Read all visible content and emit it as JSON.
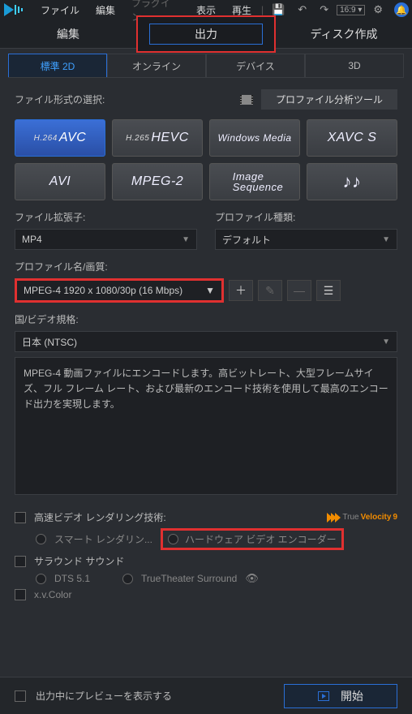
{
  "menu": {
    "file": "ファイル",
    "edit": "編集",
    "plugin": "プラグイン",
    "view": "表示",
    "play": "再生",
    "aspect": "16:9"
  },
  "main_tabs": {
    "edit": "編集",
    "output": "出力",
    "disc": "ディスク作成"
  },
  "sub_tabs": {
    "std": "標準 2D",
    "online": "オンライン",
    "device": "デバイス",
    "threed": "3D"
  },
  "format_label": "ファイル形式の選択:",
  "profile_tool": "プロファイル分析ツール",
  "formats": {
    "avc_pre": "H.264",
    "avc": "AVC",
    "hevc_pre": "H.265",
    "hevc": "HEVC",
    "wm": "Windows Media",
    "xavc": "XAVC S",
    "avi": "AVI",
    "mpeg2": "MPEG-2",
    "imgseq1": "Image",
    "imgseq2": "Sequence",
    "music": "♪♪"
  },
  "ext_label": "ファイル拡張子:",
  "ext_value": "MP4",
  "ptype_label": "プロファイル種類:",
  "ptype_value": "デフォルト",
  "pname_label": "プロファイル名/画質:",
  "pname_value": "MPEG-4 1920 x 1080/30p (16 Mbps)",
  "region_label": "国/ビデオ規格:",
  "region_value": "日本 (NTSC)",
  "description": "MPEG-4 動画ファイルにエンコードします。高ビットレート、大型フレームサイズ、フル フレーム レート、および最新のエンコード技術を使用して最高のエンコード出力を実現します。",
  "opts": {
    "render_label": "高速ビデオ レンダリング技術:",
    "svrt": "スマート レンダリン...",
    "hw": "ハードウェア ビデオ エンコーダー",
    "surround": "サラウンド サウンド",
    "dts": "DTS 5.1",
    "tts": "TrueTheater Surround",
    "xvcolor": "x.v.Color",
    "tv_true": "True",
    "tv_vel": "Velocity",
    "tv_9": "9"
  },
  "footer": {
    "preview": "出力中にプレビューを表示する",
    "start": "開始"
  }
}
